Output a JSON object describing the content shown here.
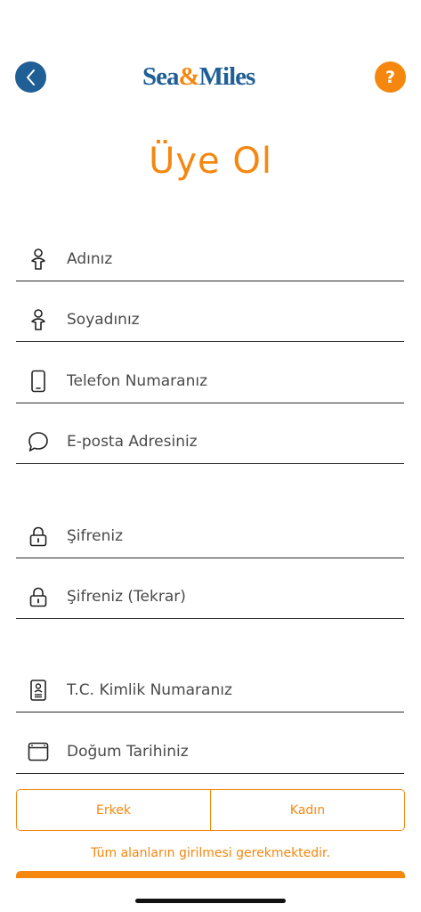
{
  "header": {
    "logo_left": "Sea",
    "logo_amp": "&",
    "logo_right": "Miles",
    "help_label": "?"
  },
  "title": "Üye Ol",
  "fields": {
    "first_name": {
      "placeholder": "Adınız",
      "icon": "person-icon"
    },
    "last_name": {
      "placeholder": "Soyadınız",
      "icon": "person-icon"
    },
    "phone": {
      "placeholder": "Telefon Numaranız",
      "icon": "phone-icon"
    },
    "email": {
      "placeholder": "E-posta Adresiniz",
      "icon": "chat-bubble-icon"
    },
    "password": {
      "placeholder": "Şifreniz",
      "icon": "lock-icon"
    },
    "password_repeat": {
      "placeholder": "Şifreniz (Tekrar)",
      "icon": "lock-icon"
    },
    "tc_id": {
      "placeholder": "T.C. Kimlik Numaranız",
      "icon": "id-card-icon"
    },
    "birth_date": {
      "placeholder": "Doğum Tarihiniz",
      "icon": "calendar-icon"
    }
  },
  "gender": {
    "male": "Erkek",
    "female": "Kadın"
  },
  "note": "Tüm alanların girilmesi gerekmektedir.",
  "colors": {
    "brand_blue": "#1f5f95",
    "accent_orange": "#f5870f"
  }
}
